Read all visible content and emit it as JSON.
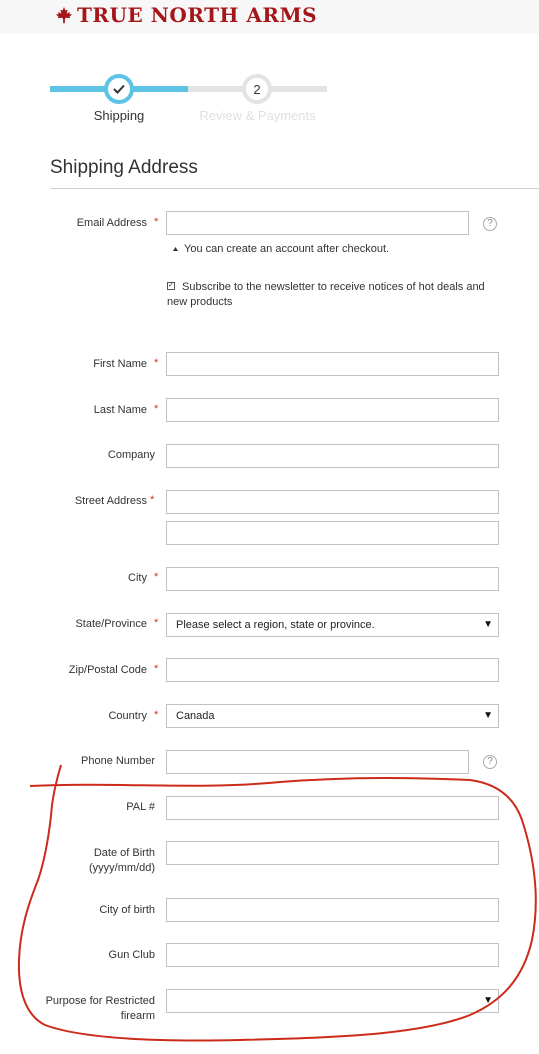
{
  "header": {
    "brand": "TRUE NORTH ARMS",
    "brand_color": "#a5161a",
    "logo_icon": "maple-leaf-icon"
  },
  "progress": {
    "steps": [
      {
        "number": "1",
        "label": "Shipping",
        "status": "complete"
      },
      {
        "number": "2",
        "label": "Review & Payments",
        "status": "pending"
      }
    ],
    "accent": "#5dc4e6"
  },
  "form": {
    "title": "Shipping Address",
    "required_marker": "*",
    "email_label": "Email Address",
    "email_value": "",
    "account_note": "You can create an account after checkout.",
    "newsletter_label": "Subscribe to the newsletter to receive notices of hot deals and new products",
    "newsletter_checked": true,
    "first_name_label": "First Name",
    "last_name_label": "Last Name",
    "company_label": "Company",
    "street_label": "Street Address",
    "city_label": "City",
    "region_label": "State/Province",
    "region_value": "Please select a region, state or province.",
    "zip_label": "Zip/Postal Code",
    "country_label": "Country",
    "country_value": "Canada",
    "phone_label": "Phone Number",
    "pal_label": "PAL #",
    "dob_label": "Date of Birth",
    "dob_hint": "(yyyy/mm/dd)",
    "birth_city_label": "City of birth",
    "gun_club_label": "Gun Club",
    "purpose_label_1": "Purpose for Restricted",
    "purpose_label_2": "firearm",
    "purpose_value": "",
    "help_glyph": "?",
    "dropdown_glyph": "▼"
  },
  "annotation": {
    "color": "#cc2a1a"
  }
}
